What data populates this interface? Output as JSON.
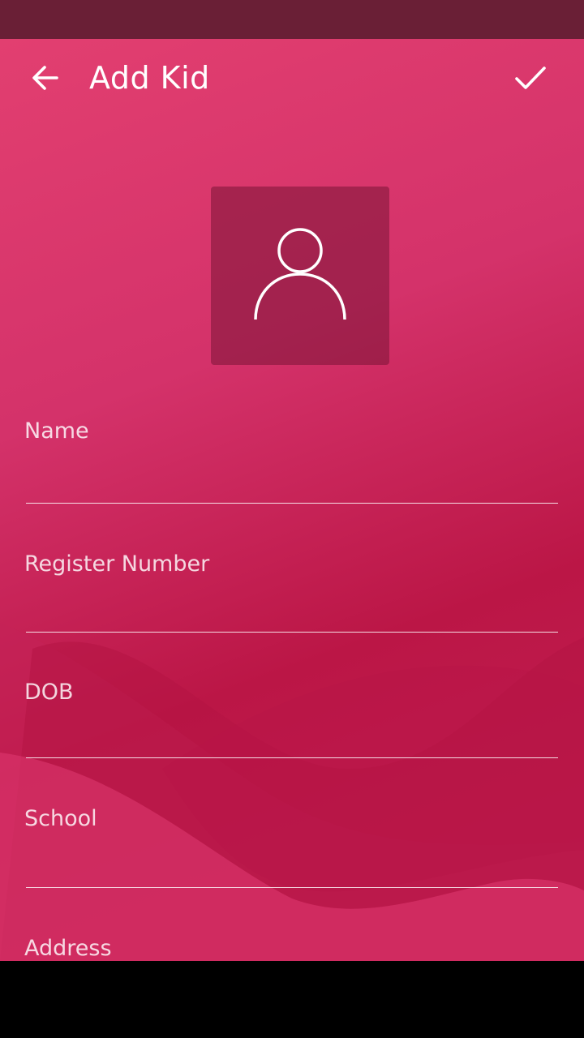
{
  "app_bar": {
    "title": "Add Kid",
    "back_icon": "arrow-left-icon",
    "save_icon": "check-icon"
  },
  "avatar": {
    "icon": "person-outline-icon"
  },
  "form": {
    "fields": [
      {
        "label": "Name"
      },
      {
        "label": "Register Number"
      },
      {
        "label": "DOB"
      },
      {
        "label": "School"
      },
      {
        "label": "Address"
      }
    ]
  },
  "colors": {
    "status_bar": "#6a1f36",
    "accent": "#d4326a",
    "accent_dark": "#bb1646",
    "avatar_bg": "#8f1e45"
  }
}
